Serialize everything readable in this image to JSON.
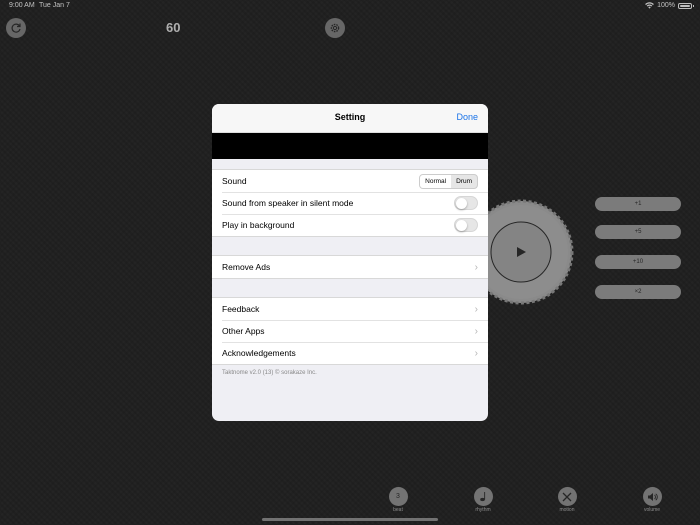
{
  "status_bar": {
    "time": "9:00 AM",
    "date": "Tue Jan 7",
    "battery": "100%"
  },
  "metronome": {
    "bpm": "60",
    "increment_buttons": [
      "+1",
      "+5",
      "+10",
      "×2"
    ],
    "bottom_bar": [
      {
        "label": "beat",
        "value": "3",
        "icon": "number"
      },
      {
        "label": "rhythm",
        "icon": "note-icon"
      },
      {
        "label": "motion",
        "icon": "cross-icon"
      },
      {
        "label": "volume",
        "icon": "speaker-icon"
      }
    ]
  },
  "settings": {
    "title": "Setting",
    "done": "Done",
    "sound": {
      "label": "Sound",
      "options": [
        "Normal",
        "Drum"
      ],
      "selected": "Normal"
    },
    "silent_mode": {
      "label": "Sound from speaker in silent mode",
      "on": false
    },
    "background": {
      "label": "Play in background",
      "on": false
    },
    "remove_ads": "Remove Ads",
    "feedback": "Feedback",
    "other_apps": "Other Apps",
    "acknowledgements": "Acknowledgements",
    "version": "Taktnome v2.0 (13) © sorakaze Inc."
  },
  "colors": {
    "accent": "#1a73e8",
    "background": "#2a2a2a"
  }
}
